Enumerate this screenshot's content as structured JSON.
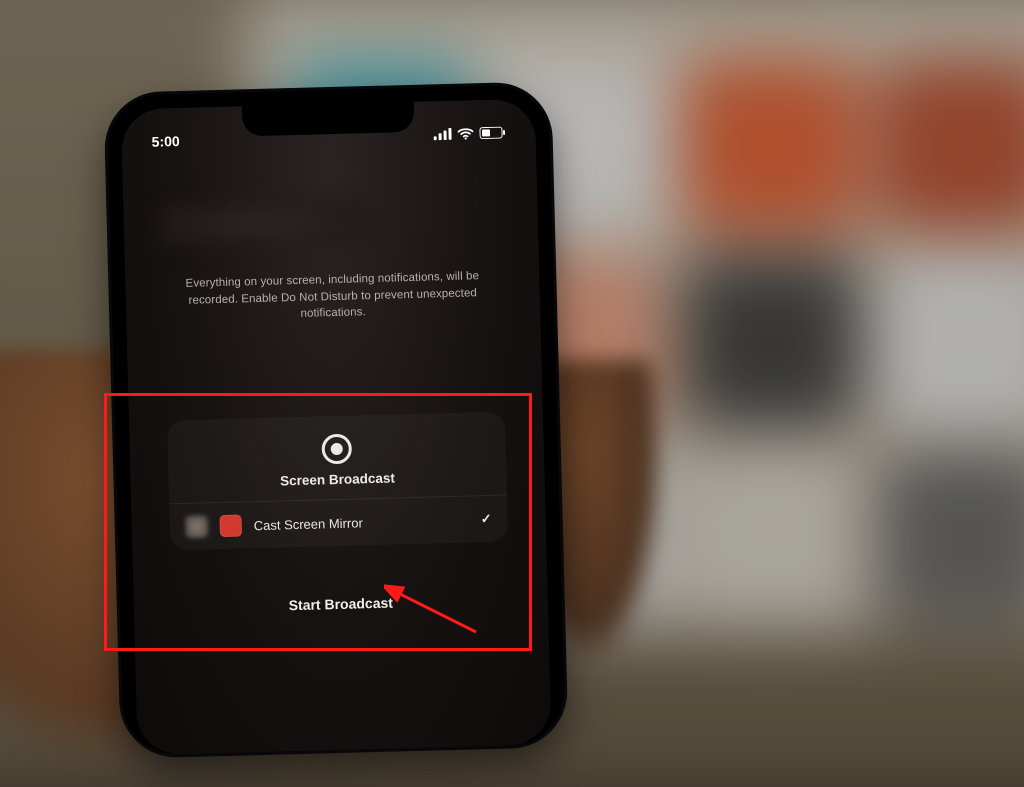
{
  "statusbar": {
    "time": "5:00"
  },
  "disclaimer": "Everything on your screen, including notifications, will be recorded. Enable Do Not Disturb to prevent unexpected notifications.",
  "broadcast": {
    "heading": "Screen Broadcast",
    "option_label": "Cast Screen Mirror",
    "option_checked": "✓",
    "start_label": "Start Broadcast"
  }
}
